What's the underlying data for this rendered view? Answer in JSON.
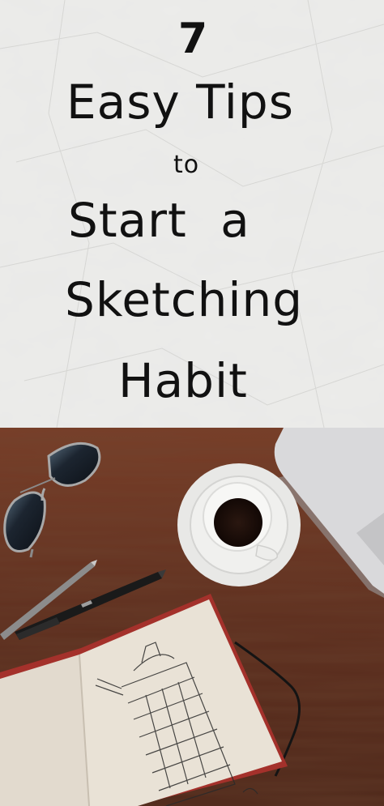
{
  "title": {
    "number": "7",
    "line1": "Easy Tips",
    "line2": "to",
    "line3": "Start a",
    "line4": "Sketching",
    "line5": "Habit"
  },
  "colors": {
    "paper": "#e9e9e7",
    "text": "#111111",
    "desk": "#6b3523",
    "saucer": "#e6e6e4",
    "coffee": "#1a0d08",
    "laptop": "#d7d7d9",
    "notebook_cover": "#b8322a",
    "page": "#e4ddd1"
  },
  "icons": [
    "sunglasses-icon",
    "coffee-cup-icon",
    "pencil-icon",
    "pen-icon",
    "laptop-icon",
    "sketchbook-icon"
  ]
}
